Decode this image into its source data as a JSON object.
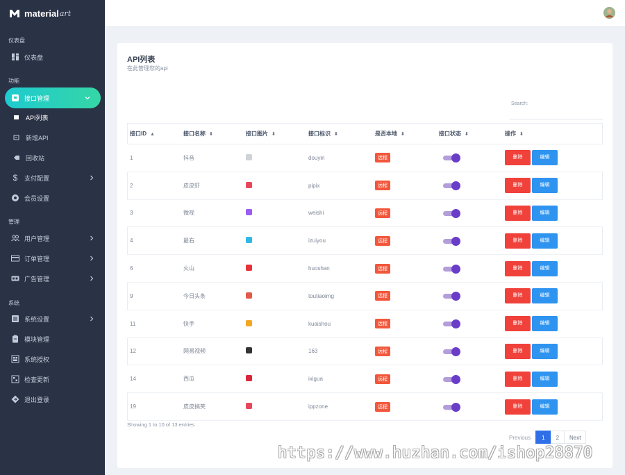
{
  "brand": {
    "name": "material",
    "suffix": "art"
  },
  "sidebar": {
    "sections": [
      "仪表盘",
      "功能",
      "管理",
      "系统"
    ],
    "dashboard": "仪表盘",
    "api_mgmt": "接口管理",
    "api_list": "API列表",
    "add_api": "新增API",
    "recycle": "回收站",
    "billing": "支付配置",
    "member": "会员设置",
    "users": "用户管理",
    "orders": "订单管理",
    "ads": "广告管理",
    "settings": "系统设置",
    "modules": "模块管理",
    "license": "系统授权",
    "update": "检查更新",
    "logout": "退出登录"
  },
  "card": {
    "title": "API列表",
    "subtitle": "在此管理您的api",
    "search_label": "Search:",
    "search_value": ""
  },
  "table": {
    "headers": [
      "接口ID",
      "接口名称",
      "接口图片",
      "接口标识",
      "是否本地",
      "接口状态",
      "操作"
    ],
    "badge": "远程",
    "delete_label": "删除",
    "edit_label": "编辑",
    "rows": [
      {
        "id": "1",
        "name": "抖音",
        "slug": "douyin",
        "color": "#cfd3d8"
      },
      {
        "id": "2",
        "name": "皮皮虾",
        "slug": "pipix",
        "color": "#e9465b"
      },
      {
        "id": "3",
        "name": "微视",
        "slug": "weishi",
        "color": "#9b5cf0"
      },
      {
        "id": "4",
        "name": "最右",
        "slug": "izuiyou",
        "color": "#2eb8e6"
      },
      {
        "id": "6",
        "name": "火山",
        "slug": "huoshan",
        "color": "#e8323a"
      },
      {
        "id": "9",
        "name": "今日头条",
        "slug": "toutiaoimg",
        "color": "#e25a4a"
      },
      {
        "id": "11",
        "name": "快手",
        "slug": "kuaishou",
        "color": "#f5a623"
      },
      {
        "id": "12",
        "name": "网易视频",
        "slug": "163",
        "color": "#333333"
      },
      {
        "id": "14",
        "name": "西瓜",
        "slug": "ixigua",
        "color": "#d9263b"
      },
      {
        "id": "19",
        "name": "皮皮搞笑",
        "slug": "ippzone",
        "color": "#e9465b"
      }
    ]
  },
  "footer": {
    "showing": "Showing 1 to 10 of 13 entries",
    "prev": "Previous",
    "pages": [
      "1",
      "2"
    ],
    "next": "Next"
  },
  "watermark": "https://www.huzhan.com/ishop28870"
}
